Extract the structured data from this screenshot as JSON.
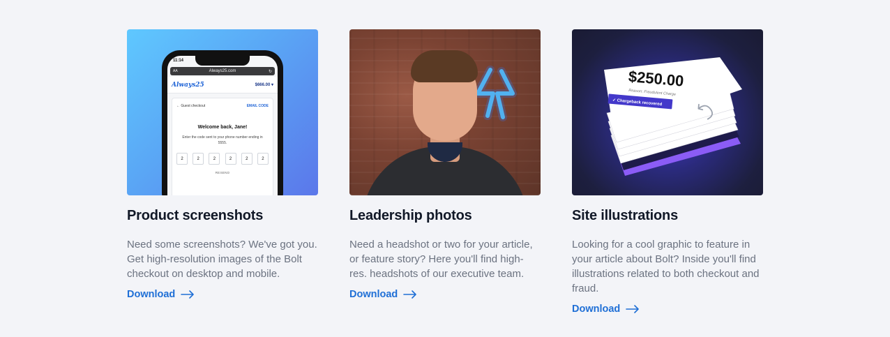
{
  "cards": [
    {
      "title": "Product screenshots",
      "description": "Need some screenshots? We've got you. Get high-resolution images of the Bolt checkout on desktop and mobile.",
      "link": "Download",
      "mockup": {
        "time": "11:14",
        "url_aa": "AA",
        "url": "Always25.com",
        "logo": "Always25",
        "cart": "$666.00 ▾",
        "guest": "← Guest checkout",
        "email_code": "EMAIL CODE",
        "welcome": "Welcome back, Jane!",
        "instructions": "Enter the code sent to your phone number ending in 5555.",
        "codes": [
          "2",
          "2",
          "2",
          "2",
          "2",
          "2"
        ],
        "resend": "RESEND"
      }
    },
    {
      "title": "Leadership photos",
      "description": "Need a headshot or two for your article, or feature story? Here you'll find high-res. headshots of our executive team.",
      "link": "Download"
    },
    {
      "title": "Site illustrations",
      "description": "Looking for a cool graphic to feature in your article about Bolt? Inside you'll find illustrations related to both checkout and fraud.",
      "link": "Download",
      "illustration": {
        "amount": "$250.00",
        "reason": "Reason: Fraudulent Charge",
        "badge": "✓ Chargeback recovered"
      }
    }
  ],
  "colors": {
    "page_bg": "#f3f4f8",
    "link": "#1f6fd6",
    "title": "#111827",
    "body_text": "#6b7280"
  },
  "icons": [
    "arrow-right-icon",
    "bolt-logo-icon",
    "undo-icon"
  ]
}
